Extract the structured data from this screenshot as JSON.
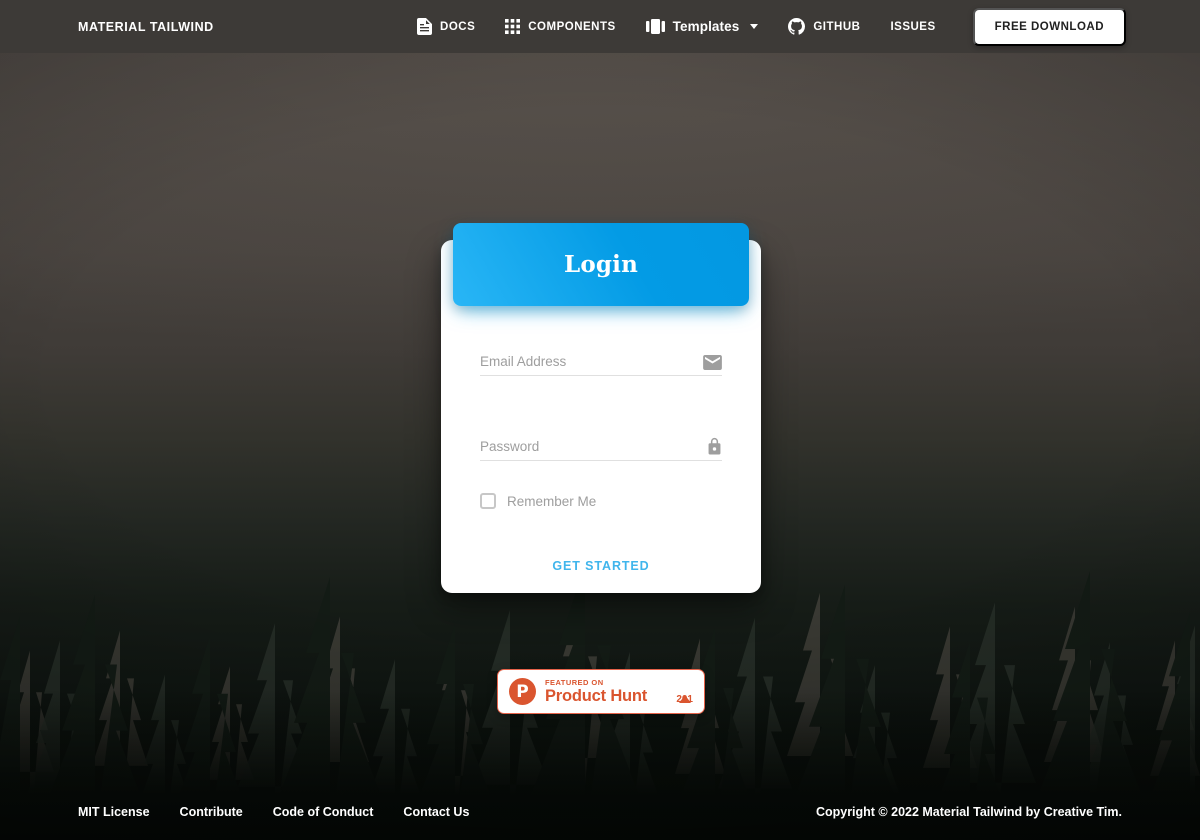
{
  "navbar": {
    "brand": "MATERIAL TAILWIND",
    "items": [
      {
        "label": "DOCS",
        "icon": "document-icon",
        "style": "caps"
      },
      {
        "label": "COMPONENTS",
        "icon": "grid-icon",
        "style": "caps"
      },
      {
        "label": "Templates",
        "icon": "carousel-icon",
        "style": "mixed",
        "has_caret": true
      },
      {
        "label": "GITHUB",
        "icon": "github-icon",
        "style": "caps"
      },
      {
        "label": "ISSUES",
        "icon": "",
        "style": "caps"
      }
    ],
    "cta_label": "FREE DOWNLOAD"
  },
  "login_card": {
    "title": "Login",
    "header_color": "#03A9F4",
    "email": {
      "placeholder": "Email Address",
      "value": "",
      "icon": "email-icon"
    },
    "password": {
      "placeholder": "Password",
      "value": "",
      "icon": "lock-icon"
    },
    "remember": {
      "label": "Remember Me",
      "checked": false
    },
    "submit_label": "GET STARTED",
    "submit_color": "#40B5EC"
  },
  "product_hunt": {
    "logo_letter": "P",
    "featured_text": "FEATURED ON",
    "name": "Product Hunt",
    "upvote_count": "201",
    "brand_color": "#DA552F"
  },
  "footer": {
    "links": [
      "MIT License",
      "Contribute",
      "Code of Conduct",
      "Contact Us"
    ],
    "copyright": "Copyright © 2022 Material Tailwind by Creative Tim."
  },
  "background": {
    "scene": "misty-pine-forest"
  }
}
